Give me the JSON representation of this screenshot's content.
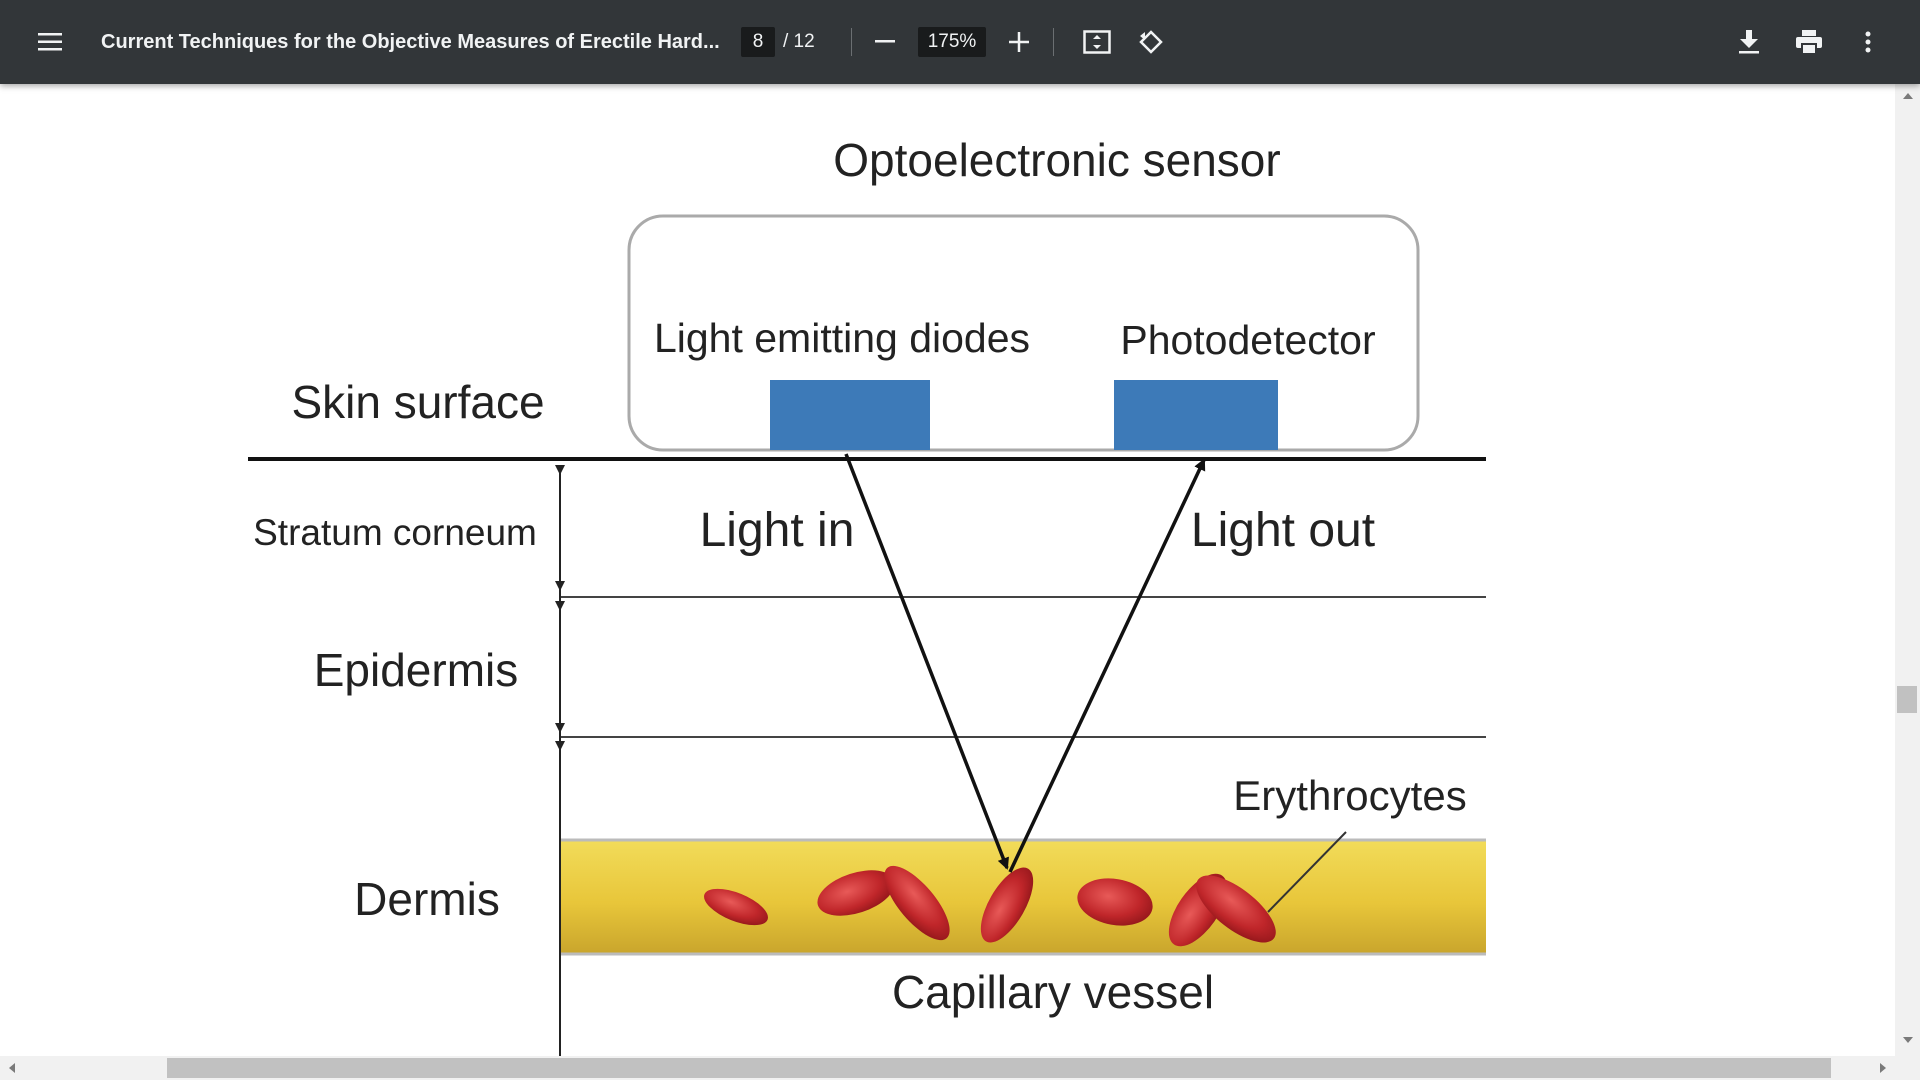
{
  "toolbar": {
    "title": "Current Techniques for the Objective Measures of Erectile Hard...",
    "page_current": "8",
    "page_total": "/ 12",
    "zoom": "175%"
  },
  "icons": {
    "menu": "menu-icon",
    "zoom_out": "minus-icon",
    "zoom_in": "plus-icon",
    "fit": "fit-to-page-icon",
    "rotate": "rotate-icon",
    "download": "download-icon",
    "print": "print-icon",
    "more": "more-vert-icon"
  },
  "diagram": {
    "sensor_title": "Optoelectronic sensor",
    "led_label": "Light emitting diodes",
    "detector_label": "Photodetector",
    "skin_surface": "Skin surface",
    "stratum": "Stratum corneum",
    "epidermis": "Epidermis",
    "dermis": "Dermis",
    "light_in": "Light in",
    "light_out": "Light out",
    "erythrocytes": "Erythrocytes",
    "capillary": "Capillary vessel"
  },
  "colors": {
    "toolbar_bg": "#323639",
    "sensor_blue": "#3d7ab8",
    "vessel_yellow": "#e8c63a",
    "cell_red": "#c0262a"
  }
}
